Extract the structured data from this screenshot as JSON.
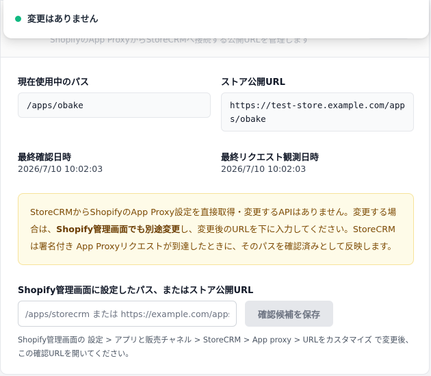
{
  "toast": {
    "message": "変更はありません",
    "status_color": "#10b981"
  },
  "header": {
    "subtitle": "ShopifyのApp ProxyからStoreCRMへ接続する公開URLを管理します"
  },
  "current_path": {
    "label": "現在使用中のパス",
    "value": "/apps/obake"
  },
  "public_url": {
    "label": "ストア公開URL",
    "value": "https://test-store.example.com/apps/obake"
  },
  "last_confirmed": {
    "label": "最終確認日時",
    "value": "2026/7/10 10:02:03"
  },
  "last_request": {
    "label": "最終リクエスト観測日時",
    "value": "2026/7/10 10:02:03"
  },
  "notice": {
    "part1": "StoreCRMからShopifyのApp Proxy設定を直接取得・変更するAPIはありません。変更する場合は、",
    "bold": "Shopify管理画面でも別途変更",
    "part2": "し、変更後のURLを下に入力してください。StoreCRMは署名付き App Proxyリクエストが到達したときに、そのパスを確認済みとして反映します。"
  },
  "form": {
    "label": "Shopify管理画面に設定したパス、またはストア公開URL",
    "value": "",
    "placeholder": "/apps/storecrm または https://example.com/apps/storecrm",
    "save_label": "確認候補を保存",
    "help": "Shopify管理画面の 設定 > アプリと販売チャネル > StoreCRM > App proxy > URLをカスタマイズ で変更後、この確認URLを開いてください。"
  }
}
